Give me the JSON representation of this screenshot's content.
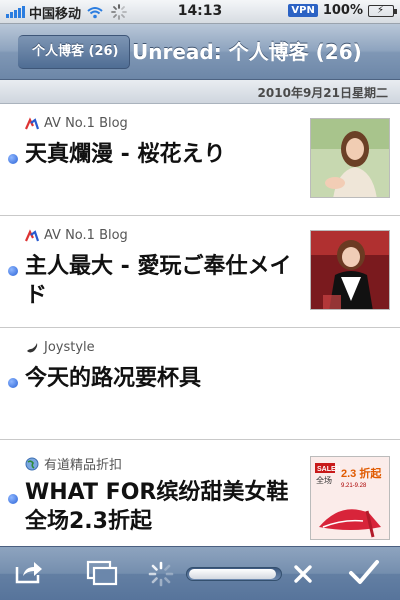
{
  "status_bar": {
    "carrier": "中国移动",
    "time": "14:13",
    "vpn_label": "VPN",
    "battery_pct": "100%",
    "battery_level": 1.0,
    "wifi_icon": "wifi-icon",
    "activity_icon": "spinner-icon"
  },
  "nav": {
    "back_label": "个人博客 (26)",
    "title": "Unread: 个人博客 (26)"
  },
  "date_header": "2010年9月21日星期二",
  "articles": [
    {
      "source": "AV No.1 Blog",
      "title": "天真爛漫 - 桜花えり",
      "unread": true,
      "has_thumb": true,
      "source_icon": "av-logo-icon"
    },
    {
      "source": "AV No.1 Blog",
      "title": "主人最大 - 愛玩ご奉仕メイド",
      "unread": true,
      "has_thumb": true,
      "source_icon": "av-logo-icon"
    },
    {
      "source": "Joystyle",
      "title": "今天的路况要杯具",
      "unread": true,
      "has_thumb": false,
      "source_icon": "joystyle-icon"
    },
    {
      "source": "有道精品折扣",
      "title": "WHAT FOR缤纷甜美女鞋 全场2.3折起",
      "unread": true,
      "has_thumb": true,
      "source_icon": "globe-icon",
      "thumb_text": {
        "brand": "SALE!!",
        "label": "全场",
        "discount": "2.3 折起",
        "dates": "9.21-9.28"
      }
    }
  ],
  "toolbar": {
    "share_icon": "share-icon",
    "windows_icon": "windows-icon",
    "loading_icon": "spinner-icon",
    "progress": 0.95,
    "close_icon": "close-icon",
    "check_icon": "checkmark-icon"
  },
  "colors": {
    "nav_blue": "#7f97b5",
    "unread_dot": "#2a63d6",
    "vpn": "#2b62c4"
  }
}
